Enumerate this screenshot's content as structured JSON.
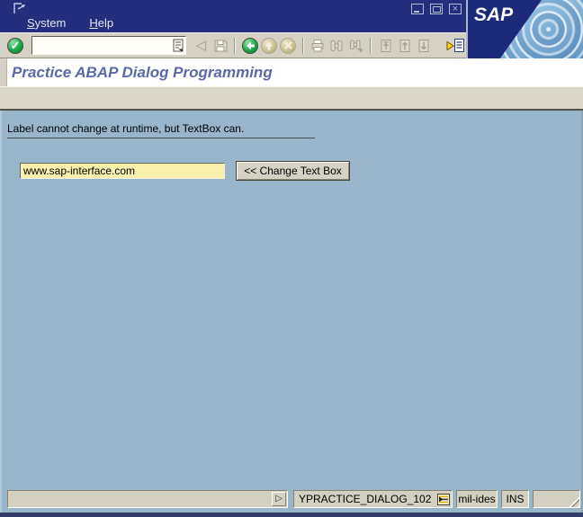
{
  "window": {
    "logo": "SAP",
    "controls": {
      "minimize": "minimize",
      "maximize": "maximize",
      "close": "close"
    }
  },
  "menu": {
    "items": [
      {
        "label": "System"
      },
      {
        "label": "Help"
      }
    ]
  },
  "toolbar": {
    "command_value": ""
  },
  "screen": {
    "title": "Practice ABAP Dialog Programming"
  },
  "main": {
    "label": "Label cannot change at runtime, but TextBox can.",
    "textbox": {
      "value": "www.sap-interface.com"
    },
    "button": "<< Change Text Box"
  },
  "statusbar": {
    "message": "",
    "transaction": "YPRACTICE_DIALOG_102",
    "server": "mil-ides",
    "mode": "INS"
  },
  "icons": {
    "system-menu-icon": "window-exit-arrow",
    "minimize-icon": "underscore-box",
    "maximize-icon": "box-in-box",
    "close-icon": "x-box",
    "enter-icon": "green-circle-check",
    "command-history-icon": "list-dropdown",
    "previous-item-icon": "left-outline-triangle",
    "save-icon": "floppy-disk",
    "back-icon": "green-circle-left-arrow",
    "exit-icon": "tan-circle-up-arrow",
    "cancel-icon": "tan-circle-x",
    "print-icon": "printer",
    "find-icon": "binoculars",
    "find-next-icon": "binoculars-plus",
    "first-page-icon": "page-arrow-top",
    "page-up-icon": "page-arrow-up",
    "page-down-icon": "page-arrow-down",
    "new-session-icon": "yellow-arrow-document",
    "status-expand-icon": "right-outline-triangle",
    "transaction-list-icon": "document-list-arrow",
    "resize-grip-icon": "diagonal-lines"
  },
  "colors": {
    "titlebar": "#242e7d",
    "toolbar": "#d5d1c5",
    "app_toolbar": "#dcd8c9",
    "content": "#98b5c9",
    "field_yellow": "#f7f0ad",
    "title_text": "#5b69aa",
    "status_field": "#d3cfc1",
    "logo_navy": "#1d2a7a"
  }
}
